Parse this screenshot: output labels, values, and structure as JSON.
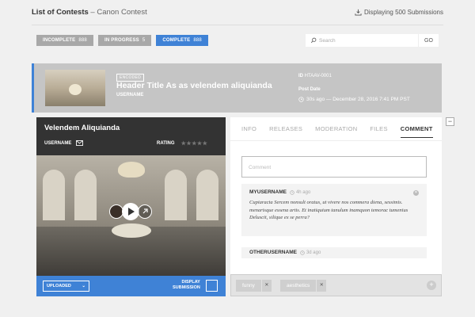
{
  "header": {
    "title": "List of Contests",
    "separator": " – ",
    "contest": "Canon Contest",
    "submissions": "Displaying 500 Submissions"
  },
  "filters": [
    {
      "label": "INCOMPLETE",
      "count": "888",
      "active": false
    },
    {
      "label": "IN PROGRESS",
      "count": "5",
      "active": false
    },
    {
      "label": "COMPLETE",
      "count": "888",
      "active": true
    }
  ],
  "search": {
    "placeholder": "Search",
    "go": "GO"
  },
  "submission": {
    "badge": "ENCODED",
    "title": "Header Title As as velendem aliquianda",
    "username": "USERNAME",
    "id_label": "ID",
    "id": "HTAAV-0001",
    "post_date_label": "Post Date",
    "post_date": "30s ago — December 28, 2016  7:41 PM PST"
  },
  "left_panel": {
    "title": "Velendem Aliquianda",
    "username": "USERNAME",
    "rating_label": "RATING",
    "stars": "★★★★★",
    "upload_status": "UPLOADED",
    "display_label_1": "DISPLAY",
    "display_label_2": "SUBMISSION"
  },
  "tabs": [
    {
      "label": "INFO",
      "active": false
    },
    {
      "label": "RELEASES",
      "active": false
    },
    {
      "label": "MODERATION",
      "active": false
    },
    {
      "label": "FILES",
      "active": false
    },
    {
      "label": "COMMENT",
      "active": true
    }
  ],
  "comments": {
    "input_placeholder": "Comment",
    "items": [
      {
        "user": "MYUSERNAME",
        "age": "4h ago",
        "text": "Cupiaracta Sercem nonsult oratus, ut vivere nos commera diena, sessimis. menarisque essena artis. Et inatiquium tanulum inamquon temorac tumenius Deluscit, silique ex se perra?"
      },
      {
        "user": "OTHERUSERNAME",
        "age": "3d ago"
      }
    ]
  },
  "tags": [
    {
      "label": "funny"
    },
    {
      "label": "aesthetics"
    }
  ],
  "colors": {
    "accent": "#3f82d6",
    "dark": "#333333",
    "inactive_button": "#a8a8a8"
  }
}
